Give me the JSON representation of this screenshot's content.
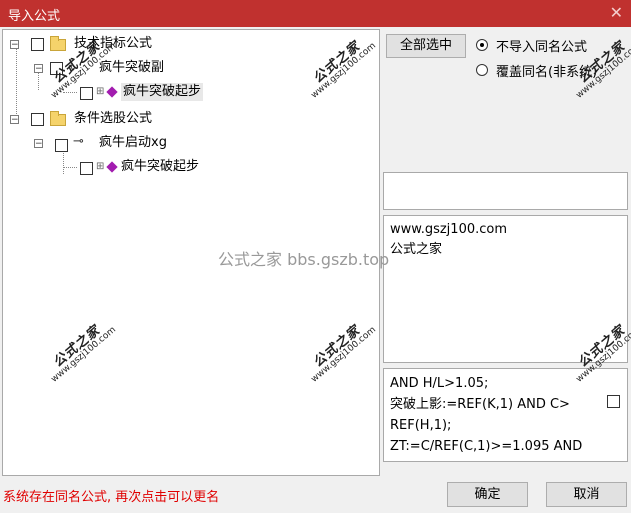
{
  "window": {
    "title": "导入公式",
    "close_glyph": "✕"
  },
  "tree": {
    "nodes": [
      {
        "label": "技术指标公式",
        "icon": "folder-icon"
      },
      {
        "label": "疯牛突破副",
        "icon": "indicator-icon"
      },
      {
        "label": "疯牛突破起步",
        "icon": "formula-gem-icon"
      },
      {
        "label": "条件选股公式",
        "icon": "folder-icon"
      },
      {
        "label": "疯牛启动xg",
        "icon": "key-icon"
      },
      {
        "label": "疯牛突破起步",
        "icon": "formula-gem-icon"
      }
    ]
  },
  "options": {
    "select_all_label": "全部选中",
    "radio_skip_label": "不导入同名公式",
    "radio_overwrite_label": "覆盖同名(非系统)",
    "selected": "不导入同名公式"
  },
  "info": {
    "line1": "www.gszj100.com",
    "line2": "公式之家"
  },
  "code_lines": [
    "AND H/L>1.05;",
    "突破上影:=REF(K,1) AND C>",
    "REF(H,1);",
    "ZT:=C/REF(C,1)>=1.095 AND"
  ],
  "watermark": {
    "stamp_text": "公式之家",
    "stamp_url": "www.gszj100.com",
    "center_text": "公式之家 bbs.gszb.top"
  },
  "status_message": "系统存在同名公式, 再次点击可以更名",
  "buttons": {
    "ok": "确定",
    "cancel": "取消"
  },
  "colors": {
    "title_bar": "#c0312f",
    "status_text": "#e00000",
    "accent_gem": "#a21caf"
  }
}
